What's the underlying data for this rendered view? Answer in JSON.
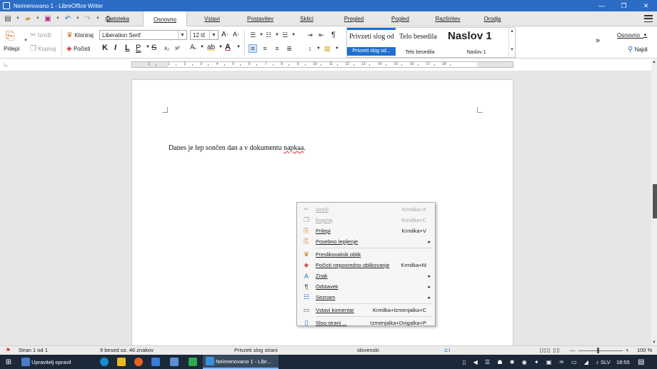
{
  "window": {
    "title": "Neimenovano 1 - LibreOffice Writer",
    "controls": [
      "—",
      "❐",
      "✕"
    ]
  },
  "menu": {
    "tabs": [
      {
        "label": "Datoteka",
        "active": false
      },
      {
        "label": "Osnovno",
        "active": true
      },
      {
        "label": "Vstavi",
        "active": false
      },
      {
        "label": "Postavitev",
        "active": false
      },
      {
        "label": "Sklici",
        "active": false
      },
      {
        "label": "Pregled",
        "active": false
      },
      {
        "label": "Pogled",
        "active": false
      },
      {
        "label": "Razširitev",
        "active": false
      },
      {
        "label": "Orodja",
        "active": false
      }
    ]
  },
  "ribbon": {
    "paste_label": "Prilepi",
    "cut_label": "Izreži",
    "copy_label": "Kopiraj",
    "clone_label": "Kloniraj",
    "clear_label": "Počisti",
    "font_name": "Liberation Serif",
    "font_size": "12 tč",
    "bold": "K",
    "italic": "I",
    "underline": "L",
    "underline_more": "P",
    "strike": "S",
    "subscript": "x₂",
    "superscript": "x²",
    "grow": "A",
    "shrink": "A",
    "styles": [
      {
        "sample": "Privzeti slog od",
        "caption": "Privzeti slog od...",
        "selected": true
      },
      {
        "sample": "Telo besedila",
        "caption": "Telo besedila",
        "selected": false
      },
      {
        "sample": "Naslov 1",
        "caption": "Naslov 1",
        "selected": false
      }
    ],
    "more": "»",
    "basic_label": "Osnovno",
    "find_label": "Najdi"
  },
  "ruler": {
    "numbers": [
      "1",
      "1",
      "2",
      "3",
      "4",
      "5",
      "6",
      "7",
      "8",
      "9",
      "10",
      "11",
      "12",
      "13",
      "14",
      "15",
      "16",
      "17",
      "18"
    ]
  },
  "document": {
    "text_before": "Danes je lep sončen dan a v dokumentu ",
    "text_error": "napkaa",
    "text_after": "."
  },
  "context_menu": {
    "items": [
      {
        "icon": "cut",
        "label": "Izreži",
        "shortcut": "Krmilka+X",
        "disabled": true,
        "submenu": false
      },
      {
        "icon": "copy",
        "label": "Kopiraj",
        "shortcut": "Krmilka+C",
        "disabled": true,
        "submenu": false
      },
      {
        "icon": "paste",
        "label": "Prilepi",
        "shortcut": "Krmilka+V",
        "disabled": false,
        "submenu": false
      },
      {
        "icon": "paste-special",
        "label": "Posebno lepljenje",
        "shortcut": "",
        "disabled": false,
        "submenu": true
      },
      {
        "sep": true
      },
      {
        "icon": "clone",
        "label": "Preslikovalnik oblik",
        "shortcut": "",
        "disabled": false,
        "submenu": false
      },
      {
        "icon": "clear",
        "label": "Počisti neposredno oblikovanje",
        "shortcut": "Krmilka+M",
        "disabled": false,
        "submenu": false
      },
      {
        "icon": "character",
        "label": "Znak",
        "shortcut": "",
        "disabled": false,
        "submenu": true
      },
      {
        "icon": "paragraph",
        "label": "Odstavek",
        "shortcut": "",
        "disabled": false,
        "submenu": true
      },
      {
        "icon": "list",
        "label": "Seznam",
        "shortcut": "",
        "disabled": false,
        "submenu": true
      },
      {
        "sep": true
      },
      {
        "icon": "comment",
        "label": "Vstavi komentar",
        "shortcut": "Krmilka+Izmenjalka+C",
        "disabled": false,
        "submenu": false
      },
      {
        "sep": true
      },
      {
        "icon": "page-style",
        "label": "Slog strani ...",
        "shortcut": "Izmenjalka+Dvigalka+P",
        "disabled": false,
        "submenu": false
      }
    ]
  },
  "statusbar": {
    "page": "Stran 1 od 1",
    "words": "9 besed oz. 46 znakov",
    "page_style": "Privzeti slog strani",
    "language": "slovenski",
    "zoom": "100 %"
  },
  "taskbar": {
    "task_manager": "Upravitelj opravil",
    "writer_task": "Neimenovano 1 - Libr...",
    "lang": "SLV",
    "time": "18:55"
  },
  "colors": {
    "titlebar": "#2b6cc4",
    "taskbar": "#1b2838",
    "style_selected": "#1e6fd0",
    "spell_error": "#dd2222"
  }
}
